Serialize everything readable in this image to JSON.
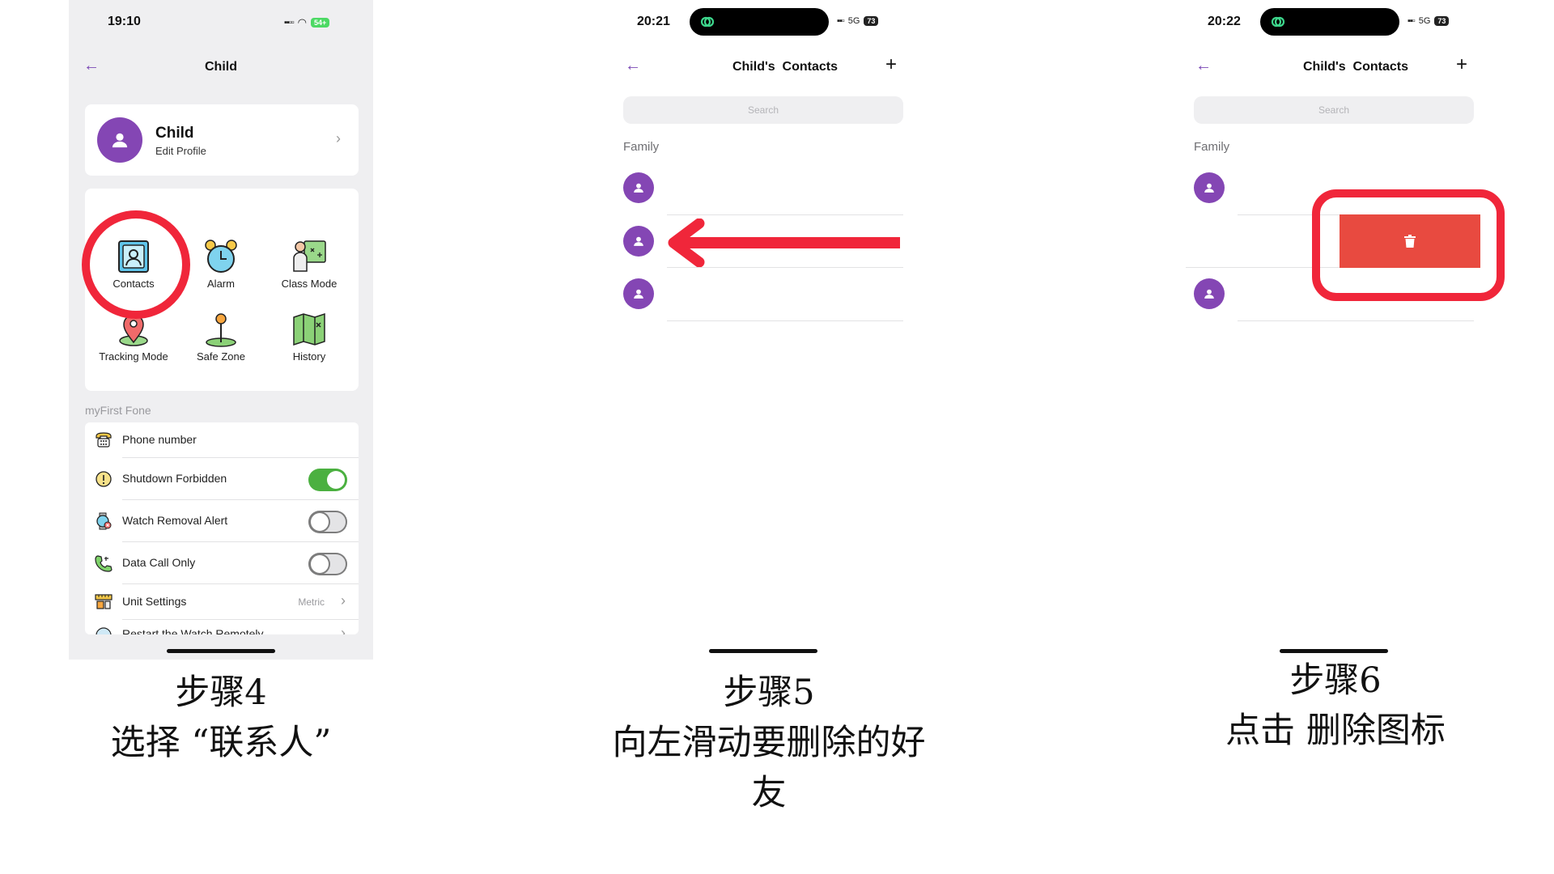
{
  "panel1": {
    "status": {
      "time": "19:10",
      "battery": "54+"
    },
    "nav": {
      "title": "Child"
    },
    "profile": {
      "name": "Child",
      "subtitle": "Edit Profile"
    },
    "grid": [
      {
        "label": "Contacts",
        "icon": "contacts-book-icon"
      },
      {
        "label": "Alarm",
        "icon": "alarm-clock-icon"
      },
      {
        "label": "Class Mode",
        "icon": "class-mode-teacher-icon"
      },
      {
        "label": "Tracking Mode",
        "icon": "map-pin-icon"
      },
      {
        "label": "Safe Zone",
        "icon": "safe-zone-pin-icon"
      },
      {
        "label": "History",
        "icon": "folded-map-icon"
      }
    ],
    "section_label": "myFirst Fone",
    "settings": [
      {
        "label": "Phone number",
        "icon": "telephone-icon"
      },
      {
        "label": "Shutdown Forbidden",
        "icon": "warning-circle-icon",
        "toggle": "on"
      },
      {
        "label": "Watch Removal Alert",
        "icon": "watch-alert-icon",
        "toggle": "off"
      },
      {
        "label": "Data Call Only",
        "icon": "phone-call-icon",
        "toggle": "off"
      },
      {
        "label": "Unit Settings",
        "icon": "ruler-icon",
        "value": "Metric"
      },
      {
        "label": "Restart the Watch Remotely",
        "icon": "restart-icon"
      }
    ]
  },
  "panel2": {
    "status": {
      "time": "20:21",
      "network": "5G",
      "battery": "73"
    },
    "nav": {
      "title": "Child's  Contacts"
    },
    "search_placeholder": "Search",
    "group_label": "Family"
  },
  "panel3": {
    "status": {
      "time": "20:22",
      "network": "5G",
      "battery": "73"
    },
    "nav": {
      "title": "Child's  Contacts"
    },
    "search_placeholder": "Search",
    "group_label": "Family"
  },
  "captions": {
    "step4": {
      "title": "步骤4",
      "text": "选择 “联系人”"
    },
    "step5": {
      "title": "步骤5",
      "text_line1": "向左滑动要删除的好",
      "text_line2": "友"
    },
    "step6": {
      "title": "步骤6",
      "text": "点击 删除图标"
    }
  },
  "colors": {
    "accent_purple": "#8446b4",
    "annotation_red": "#f0263a",
    "delete_red": "#e84a40",
    "toggle_green": "#4bb040"
  }
}
